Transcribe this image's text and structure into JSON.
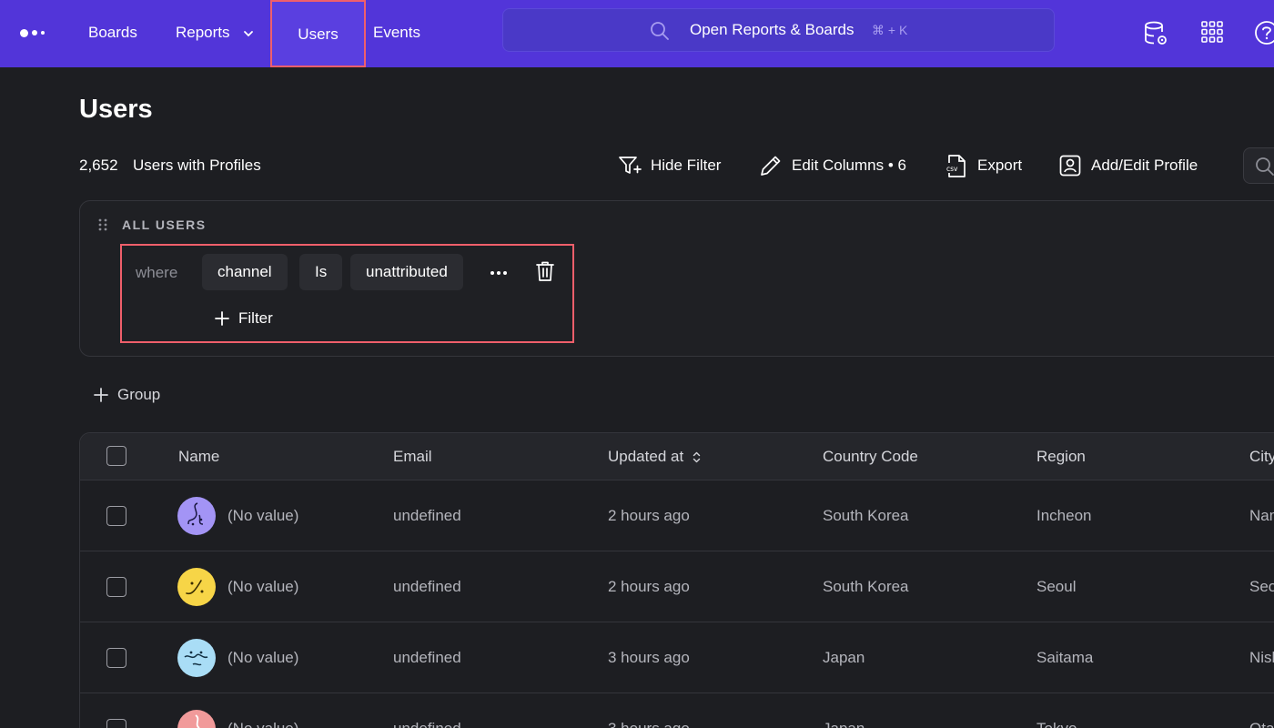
{
  "nav": {
    "items": [
      "Boards",
      "Reports",
      "Users",
      "Events"
    ],
    "search_label": "Open Reports & Boards",
    "search_shortcut": "⌘ + K",
    "icons": [
      "logo-icon",
      "database-settings-icon",
      "apps-grid-icon",
      "help-icon"
    ]
  },
  "page": {
    "title": "Users",
    "count": "2,652",
    "count_label": "Users with Profiles",
    "toolbar": {
      "hide_filter": "Hide Filter",
      "edit_columns": "Edit Columns • 6",
      "export": "Export",
      "add_edit_profile": "Add/Edit Profile"
    }
  },
  "filter": {
    "heading": "ALL USERS",
    "where": "where",
    "property": "channel",
    "operator": "Is",
    "value": "unattributed",
    "add_filter": "Filter",
    "add_group": "Group"
  },
  "table": {
    "headers": [
      "Name",
      "Email",
      "Updated at",
      "Country Code",
      "Region",
      "City"
    ],
    "rows": [
      {
        "name": "(No value)",
        "email": "undefined",
        "updated": "2 hours ago",
        "country": "South Korea",
        "region": "Incheon",
        "city": "Nam-gu",
        "avatar_color": "#a394f5"
      },
      {
        "name": "(No value)",
        "email": "undefined",
        "updated": "2 hours ago",
        "country": "South Korea",
        "region": "Seoul",
        "city": "Seoul",
        "avatar_color": "#f7d547"
      },
      {
        "name": "(No value)",
        "email": "undefined",
        "updated": "3 hours ago",
        "country": "Japan",
        "region": "Saitama",
        "city": "Nishi",
        "avatar_color": "#a9ddf6"
      },
      {
        "name": "(No value)",
        "email": "undefined",
        "updated": "3 hours ago",
        "country": "Japan",
        "region": "Tokyo",
        "city": "Ota",
        "avatar_color": "#f19a9a"
      }
    ]
  },
  "colors": {
    "nav_bg": "#5235d9",
    "page_bg": "#1d1e22",
    "highlight": "#ef5f6b"
  }
}
